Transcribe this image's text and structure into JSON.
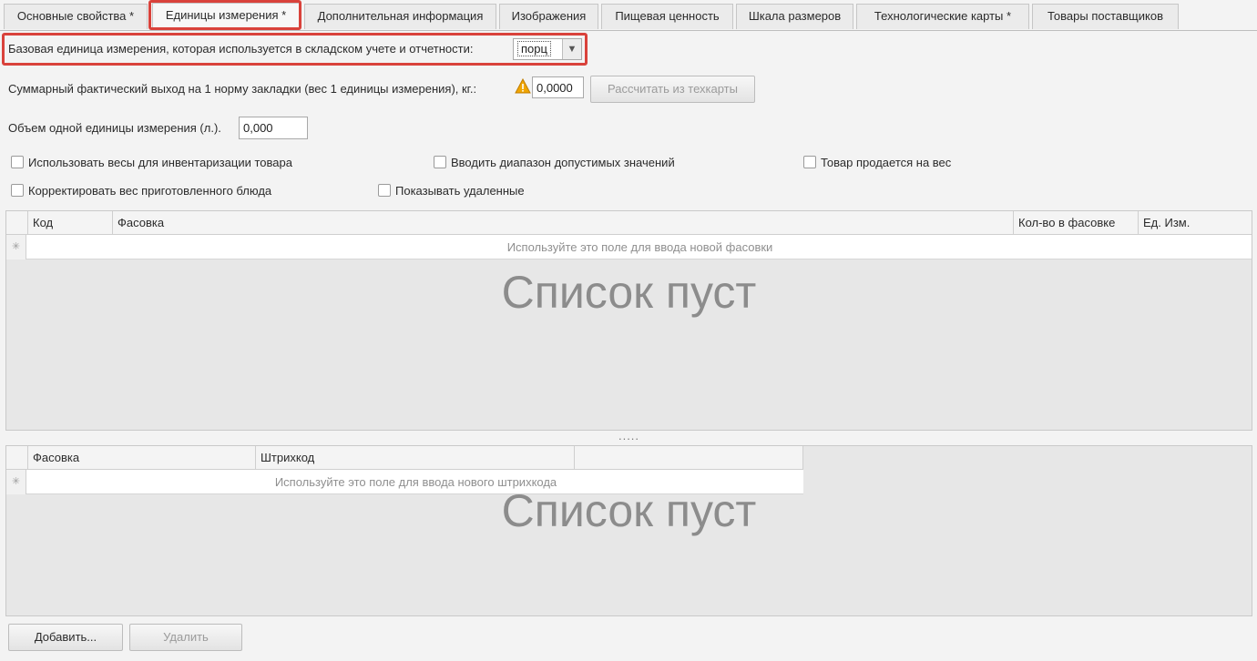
{
  "tabs": [
    {
      "label": "Основные свойства *"
    },
    {
      "label": "Единицы измерения *"
    },
    {
      "label": "Дополнительная информация"
    },
    {
      "label": "Изображения"
    },
    {
      "label": "Пищевая ценность"
    },
    {
      "label": "Шкала размеров"
    },
    {
      "label": "Технологические карты *"
    },
    {
      "label": "Товары поставщиков"
    }
  ],
  "base_unit": {
    "label": "Базовая единица измерения, которая используется в складском учете и отчетности:",
    "value": "порц"
  },
  "yield": {
    "label": "Суммарный фактический выход на 1 норму закладки (вес 1 единицы измерения), кг.:",
    "value": "0,0000",
    "calc_button": "Рассчитать из техкарты"
  },
  "volume": {
    "label": "Объем одной единицы измерения (л.).",
    "value": "0,000"
  },
  "checkboxes": [
    {
      "label": "Использовать весы для инвентаризации товара",
      "checked": false
    },
    {
      "label": "Вводить диапазон допустимых значений",
      "checked": false
    },
    {
      "label": "Товар продается на вес",
      "checked": false
    },
    {
      "label": "Корректировать вес приготовленного блюда",
      "checked": false
    },
    {
      "label": "Показывать удаленные",
      "checked": false
    }
  ],
  "packages_grid": {
    "columns": [
      "Код",
      "Фасовка",
      "Кол-во в фасовке",
      "Ед. Изм."
    ],
    "new_row_hint": "Используйте это поле для ввода новой фасовки",
    "empty_text": "Список пуст"
  },
  "splitter_text": ".....",
  "barcodes_grid": {
    "columns": [
      "Фасовка",
      "Штрихкод",
      ""
    ],
    "new_row_hint": "Используйте это поле для ввода нового штрихкода",
    "empty_text": "Список пуст"
  },
  "buttons": {
    "add": "Добавить...",
    "delete": "Удалить"
  },
  "colors": {
    "highlight": "#d9423b",
    "warning": "#f0a500"
  }
}
